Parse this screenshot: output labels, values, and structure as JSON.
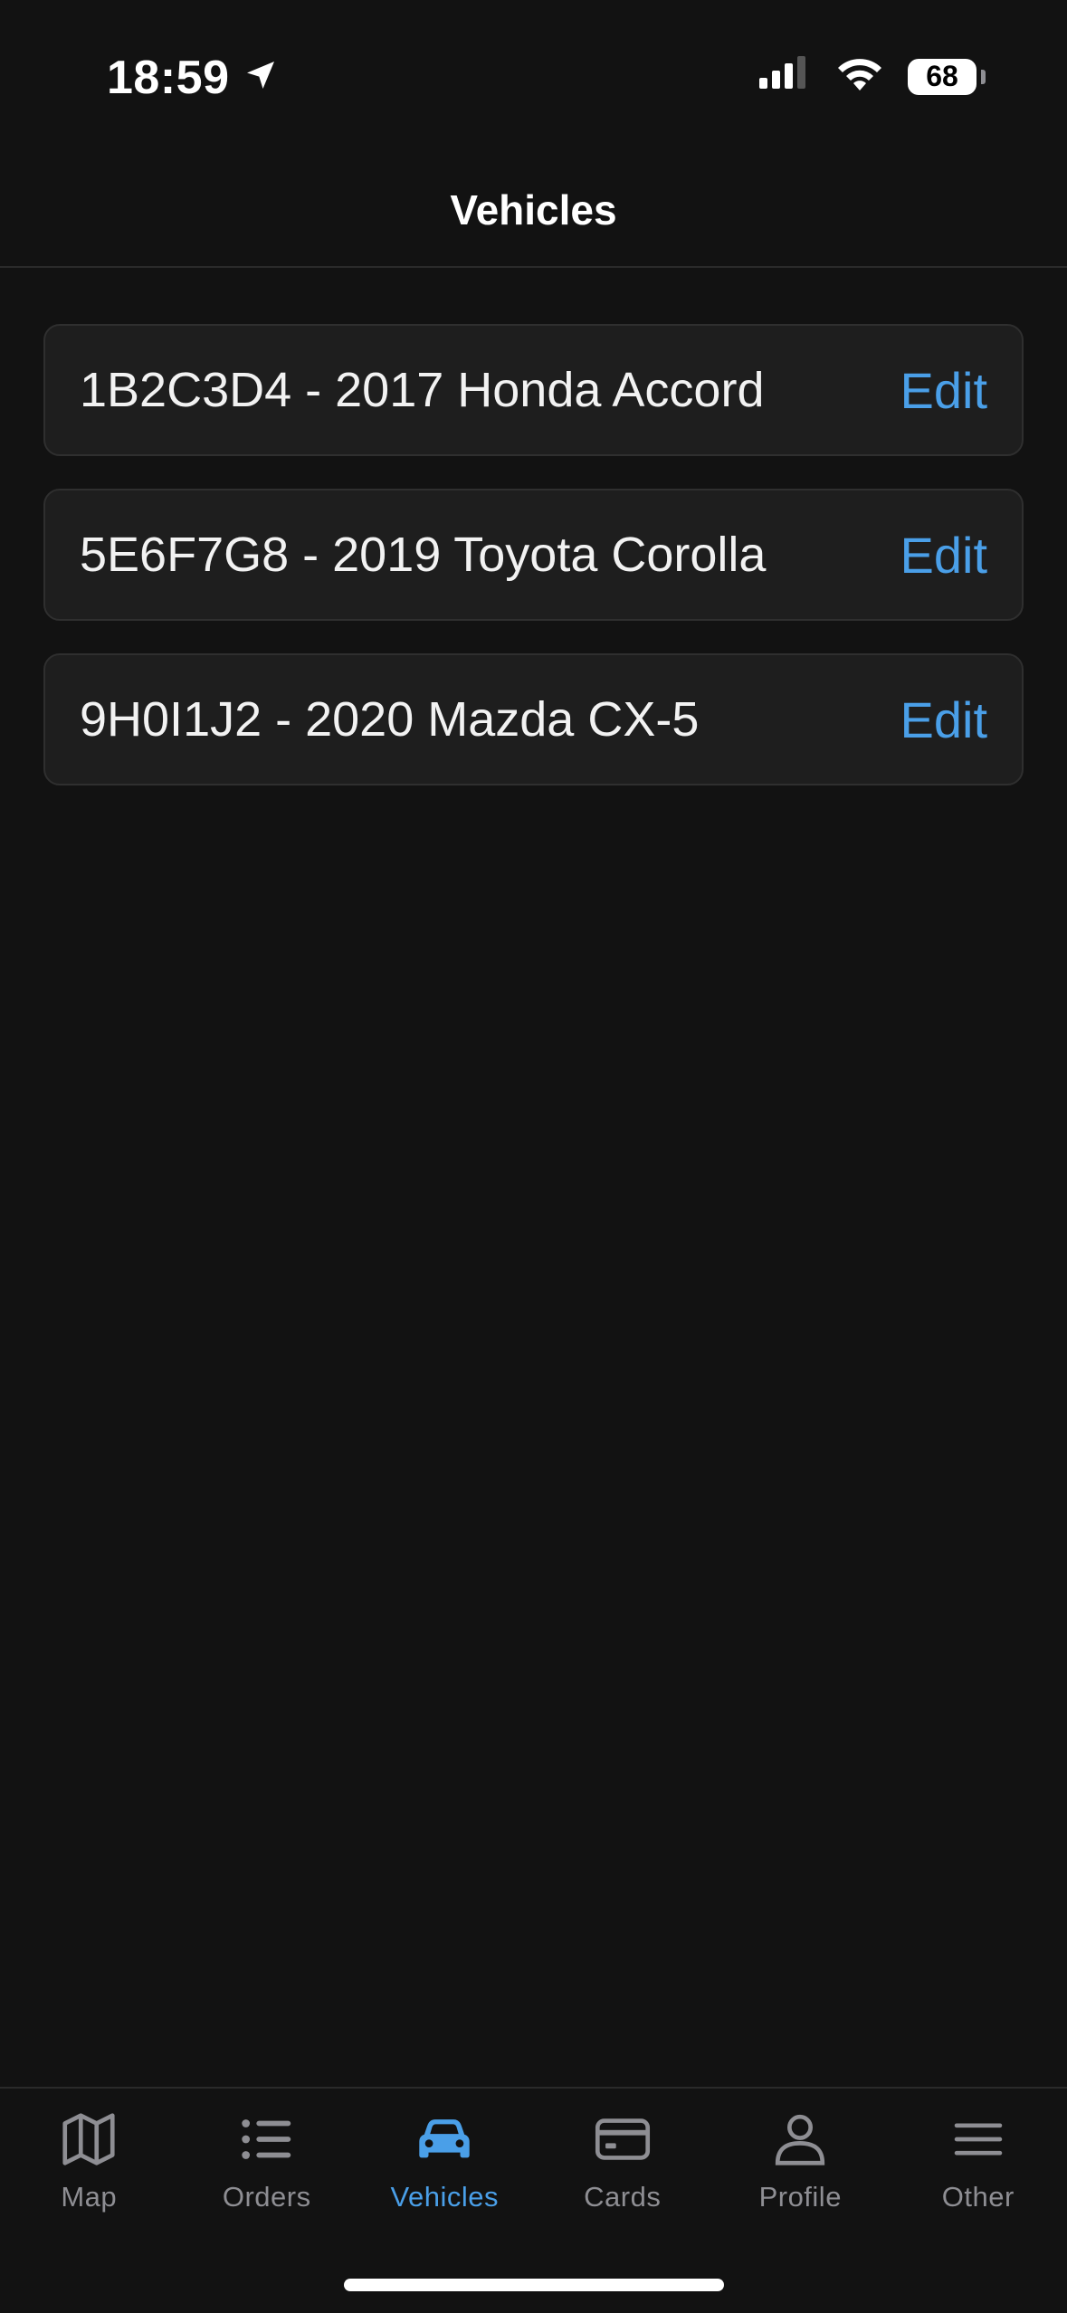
{
  "status_bar": {
    "time": "18:59",
    "battery_level": "68"
  },
  "header": {
    "title": "Vehicles"
  },
  "vehicles": [
    {
      "label": "1B2C3D4 - 2017 Honda Accord",
      "action": "Edit"
    },
    {
      "label": "5E6F7G8 - 2019 Toyota Corolla",
      "action": "Edit"
    },
    {
      "label": "9H0I1J2 - 2020 Mazda CX-5",
      "action": "Edit"
    }
  ],
  "tab_bar": {
    "active_tab": "Vehicles",
    "tabs": [
      {
        "label": "Map",
        "icon": "map-icon"
      },
      {
        "label": "Orders",
        "icon": "list-icon"
      },
      {
        "label": "Vehicles",
        "icon": "car-icon"
      },
      {
        "label": "Cards",
        "icon": "credit-card-icon"
      },
      {
        "label": "Profile",
        "icon": "person-icon"
      },
      {
        "label": "Other",
        "icon": "menu-icon"
      }
    ]
  },
  "colors": {
    "background": "#121212",
    "card": "#1e1e1e",
    "accent": "#4a9fe8",
    "inactive": "#8e8e93"
  }
}
